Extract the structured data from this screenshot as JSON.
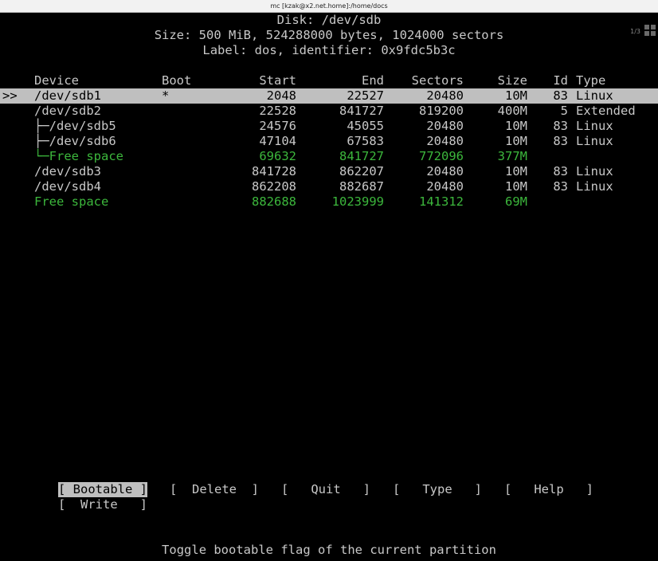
{
  "window": {
    "title": "mc [kzak@x2.net.home]:/home/docs",
    "pager": "1/3"
  },
  "disk": {
    "line1": "Disk: /dev/sdb",
    "line2": "Size: 500 MiB, 524288000 bytes, 1024000 sectors",
    "line3": "Label: dos, identifier: 0x9fdc5b3c"
  },
  "table": {
    "headers": {
      "device": "Device",
      "boot": "Boot",
      "start": "Start",
      "end": "End",
      "sectors": "Sectors",
      "size": "Size",
      "id": "Id",
      "type": "Type"
    },
    "cursor": ">>",
    "rows": [
      {
        "device": "/dev/sdb1",
        "boot": "*",
        "start": "2048",
        "end": "22527",
        "sectors": "20480",
        "size": "10M",
        "id": "83",
        "type": "Linux"
      },
      {
        "device": "/dev/sdb2",
        "boot": "",
        "start": "22528",
        "end": "841727",
        "sectors": "819200",
        "size": "400M",
        "id": "5",
        "type": "Extended"
      },
      {
        "device": "├─/dev/sdb5",
        "boot": "",
        "start": "24576",
        "end": "45055",
        "sectors": "20480",
        "size": "10M",
        "id": "83",
        "type": "Linux"
      },
      {
        "device": "├─/dev/sdb6",
        "boot": "",
        "start": "47104",
        "end": "67583",
        "sectors": "20480",
        "size": "10M",
        "id": "83",
        "type": "Linux"
      },
      {
        "device": "└─Free space",
        "boot": "",
        "start": "69632",
        "end": "841727",
        "sectors": "772096",
        "size": "377M",
        "id": "",
        "type": ""
      },
      {
        "device": "/dev/sdb3",
        "boot": "",
        "start": "841728",
        "end": "862207",
        "sectors": "20480",
        "size": "10M",
        "id": "83",
        "type": "Linux"
      },
      {
        "device": "/dev/sdb4",
        "boot": "",
        "start": "862208",
        "end": "882687",
        "sectors": "20480",
        "size": "10M",
        "id": "83",
        "type": "Linux"
      },
      {
        "device": "Free space",
        "boot": "",
        "start": "882688",
        "end": "1023999",
        "sectors": "141312",
        "size": "69M",
        "id": "",
        "type": ""
      }
    ]
  },
  "menu": {
    "bootable": "[ Bootable ]",
    "delete": "[  Delete  ]",
    "quit": "[   Quit   ]",
    "type": "[   Type   ]",
    "help": "[   Help   ]",
    "write": "[  Write   ]"
  },
  "status": "Toggle bootable flag of the current partition",
  "colors": {
    "background": "#000000",
    "text": "#c8c8c8",
    "highlight": "#bfbfbf",
    "free_space": "#3cb73c"
  }
}
